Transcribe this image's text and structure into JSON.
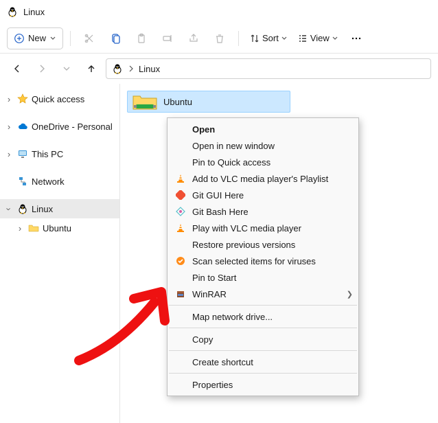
{
  "window": {
    "title": "Linux"
  },
  "toolbar": {
    "new_label": "New",
    "sort_label": "Sort",
    "view_label": "View"
  },
  "breadcrumb": {
    "item0": "Linux"
  },
  "sidebar": {
    "items": [
      {
        "label": "Quick access"
      },
      {
        "label": "OneDrive - Personal"
      },
      {
        "label": "This PC"
      },
      {
        "label": "Network"
      },
      {
        "label": "Linux"
      },
      {
        "label": "Ubuntu"
      }
    ]
  },
  "content": {
    "items": [
      {
        "label": "Ubuntu"
      }
    ]
  },
  "context_menu": {
    "items": [
      "Open",
      "Open in new window",
      "Pin to Quick access",
      "Add to VLC media player's Playlist",
      "Git GUI Here",
      "Git Bash Here",
      "Play with VLC media player",
      "Restore previous versions",
      "Scan selected items for viruses",
      "Pin to Start",
      "WinRAR",
      "Map network drive...",
      "Copy",
      "Create shortcut",
      "Properties"
    ]
  }
}
